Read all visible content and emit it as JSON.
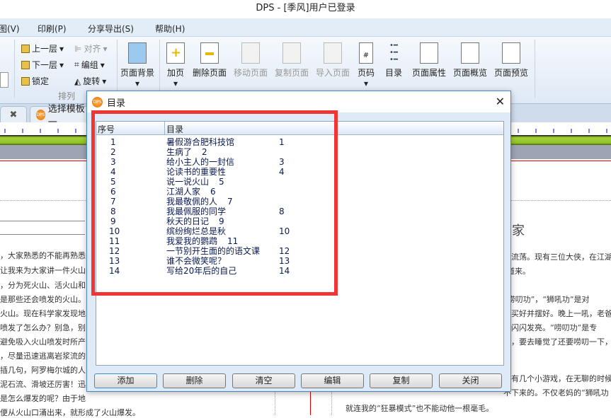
{
  "window": {
    "title": "DPS - [季风]用户已登录"
  },
  "menu": [
    "图(V)",
    "印刷(P)",
    "分享导出(S)",
    "帮助(H)"
  ],
  "ribbon": {
    "arrange": {
      "up": "上一层",
      "down": "下一层",
      "lock": "锁定",
      "align": "对齐",
      "group": "编组",
      "rotate": "旋转",
      "label": "排列"
    },
    "buttons": [
      {
        "label": "页面背景",
        "dim": false
      },
      {
        "label": "加页",
        "dim": false
      },
      {
        "label": "删除页面",
        "dim": false
      },
      {
        "label": "移动页面",
        "dim": true
      },
      {
        "label": "复制页面",
        "dim": true
      },
      {
        "label": "导入页面",
        "dim": true
      },
      {
        "label": "页码",
        "dim": false
      },
      {
        "label": "目录",
        "dim": false
      },
      {
        "label": "页面属性",
        "dim": false
      },
      {
        "label": "页面概览",
        "dim": false
      },
      {
        "label": "页面预览",
        "dim": false
      }
    ]
  },
  "tabs": {
    "active": "选择模板一"
  },
  "doc": {
    "left": [
      "，大家熟悉的不能再熟悉",
      "让我来为大家讲一件火山的",
      "，分为死火山、活火山和",
      "是那些还会喷发的火山。",
      "火山。现在科学家发现地",
      "喷发了怎么办？别急，别",
      "避免吸入火山喷发时所产",
      "，尽量迅速逃离岩浆流的",
      "插几句，阿罗梅尔城的人",
      "泥石流、滑坡还厉害！迅",
      "是怎么爆发的呢？由于地",
      "便从火山口涌出来，就形成了火山爆发。"
    ],
    "right_heading": "人家",
    "right": [
      "在流荡。现有三位大侠，在江湖",
      "道来。",
      "“唠叨功”，“狮吼功”是对",
      "致买好并摆好。晚上一吼，老爸",
      "得闪闪发亮。“唠叨功”是专",
      "下，要去睡觉了还要唠叨一下，",
      "总有几个小游戏，在无聊的时候",
      "不下来的。不仅老妈的“狮吼功",
      "就连我的“狂暴模式”也不能动他一根毫毛。"
    ]
  },
  "dialog": {
    "title": "目录",
    "columns": [
      "序号",
      "目录"
    ],
    "rows": [
      {
        "no": "1",
        "title": "暑假游合肥科技馆",
        "page": "1",
        "far": true
      },
      {
        "no": "2",
        "title": "生病了",
        "page": "2",
        "far": false
      },
      {
        "no": "3",
        "title": "给小主人的一封信",
        "page": "3",
        "far": true
      },
      {
        "no": "4",
        "title": "论读书的重要性",
        "page": "4",
        "far": true
      },
      {
        "no": "5",
        "title": "说一说火山",
        "page": "5",
        "far": false
      },
      {
        "no": "6",
        "title": "江湖人家",
        "page": "6",
        "far": false
      },
      {
        "no": "7",
        "title": "我最敬佩的人",
        "page": "7",
        "far": false
      },
      {
        "no": "8",
        "title": "我最佩服的同学",
        "page": "8",
        "far": true
      },
      {
        "no": "9",
        "title": "秋天的日记",
        "page": "9",
        "far": false
      },
      {
        "no": "10",
        "title": "缤纷绚烂总是秋",
        "page": "10",
        "far": true
      },
      {
        "no": "11",
        "title": "我爱我的鹦鹉",
        "page": "11",
        "far": false
      },
      {
        "no": "12",
        "title": "一节别开生面的的语文课",
        "page": "12",
        "far": true
      },
      {
        "no": "13",
        "title": "谁不会微笑呢？",
        "page": "13",
        "far": true
      },
      {
        "no": "14",
        "title": "写给20年后的自己",
        "page": "14",
        "far": true
      }
    ],
    "buttons": [
      "添加",
      "删除",
      "清空",
      "编辑",
      "复制",
      "关闭"
    ]
  },
  "colors": {
    "highlight": "#f03535",
    "accent": "#4b86c8"
  }
}
